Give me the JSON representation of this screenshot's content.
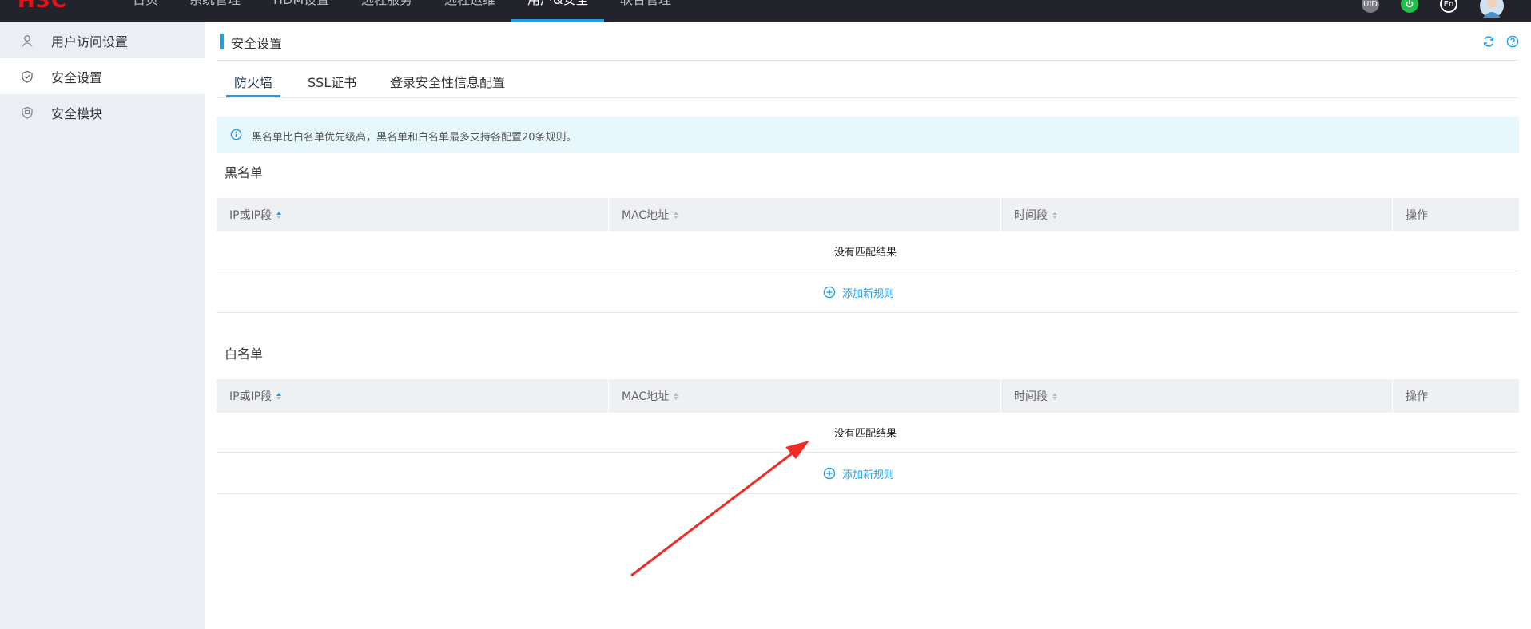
{
  "brand": {
    "logo_text": "H3C",
    "logo_color": "#e3131b"
  },
  "nav": {
    "items": [
      {
        "label": "首页"
      },
      {
        "label": "系统管理"
      },
      {
        "label": "HDM设置"
      },
      {
        "label": "远程服务"
      },
      {
        "label": "远程运维"
      },
      {
        "label": "用户&安全"
      },
      {
        "label": "联合管理"
      }
    ],
    "active": "用户&安全"
  },
  "top_icons": {
    "uid_label": "UID",
    "lang_label": "En",
    "power": "power-icon",
    "avatar": "avatar-icon"
  },
  "sidebar": {
    "items": [
      {
        "label": "用户访问设置",
        "icon": "user-icon"
      },
      {
        "label": "安全设置",
        "icon": "shield-icon",
        "active": true
      },
      {
        "label": "安全模块",
        "icon": "security-module-icon"
      }
    ]
  },
  "page": {
    "title": "安全设置",
    "tabs": [
      {
        "label": "防火墙",
        "active": true
      },
      {
        "label": "SSL证书"
      },
      {
        "label": "登录安全性信息配置"
      }
    ],
    "info": "黑名单比白名单优先级高，黑名单和白名单最多支持各配置20条规则。",
    "blacklist": {
      "title": "黑名单",
      "columns": [
        "IP或IP段",
        "MAC地址",
        "时间段",
        "操作"
      ],
      "empty_text": "没有匹配结果",
      "add_label": "添加新规则"
    },
    "whitelist": {
      "title": "白名单",
      "columns": [
        "IP或IP段",
        "MAC地址",
        "时间段",
        "操作"
      ],
      "empty_text": "没有匹配结果",
      "add_label": "添加新规则"
    }
  },
  "colors": {
    "accent": "#1f9ee8",
    "topbar": "#23232b",
    "sidebar_bg": "#eceef5",
    "info_bg": "#e7f7fc",
    "annotation_arrow": "#f02c24"
  }
}
